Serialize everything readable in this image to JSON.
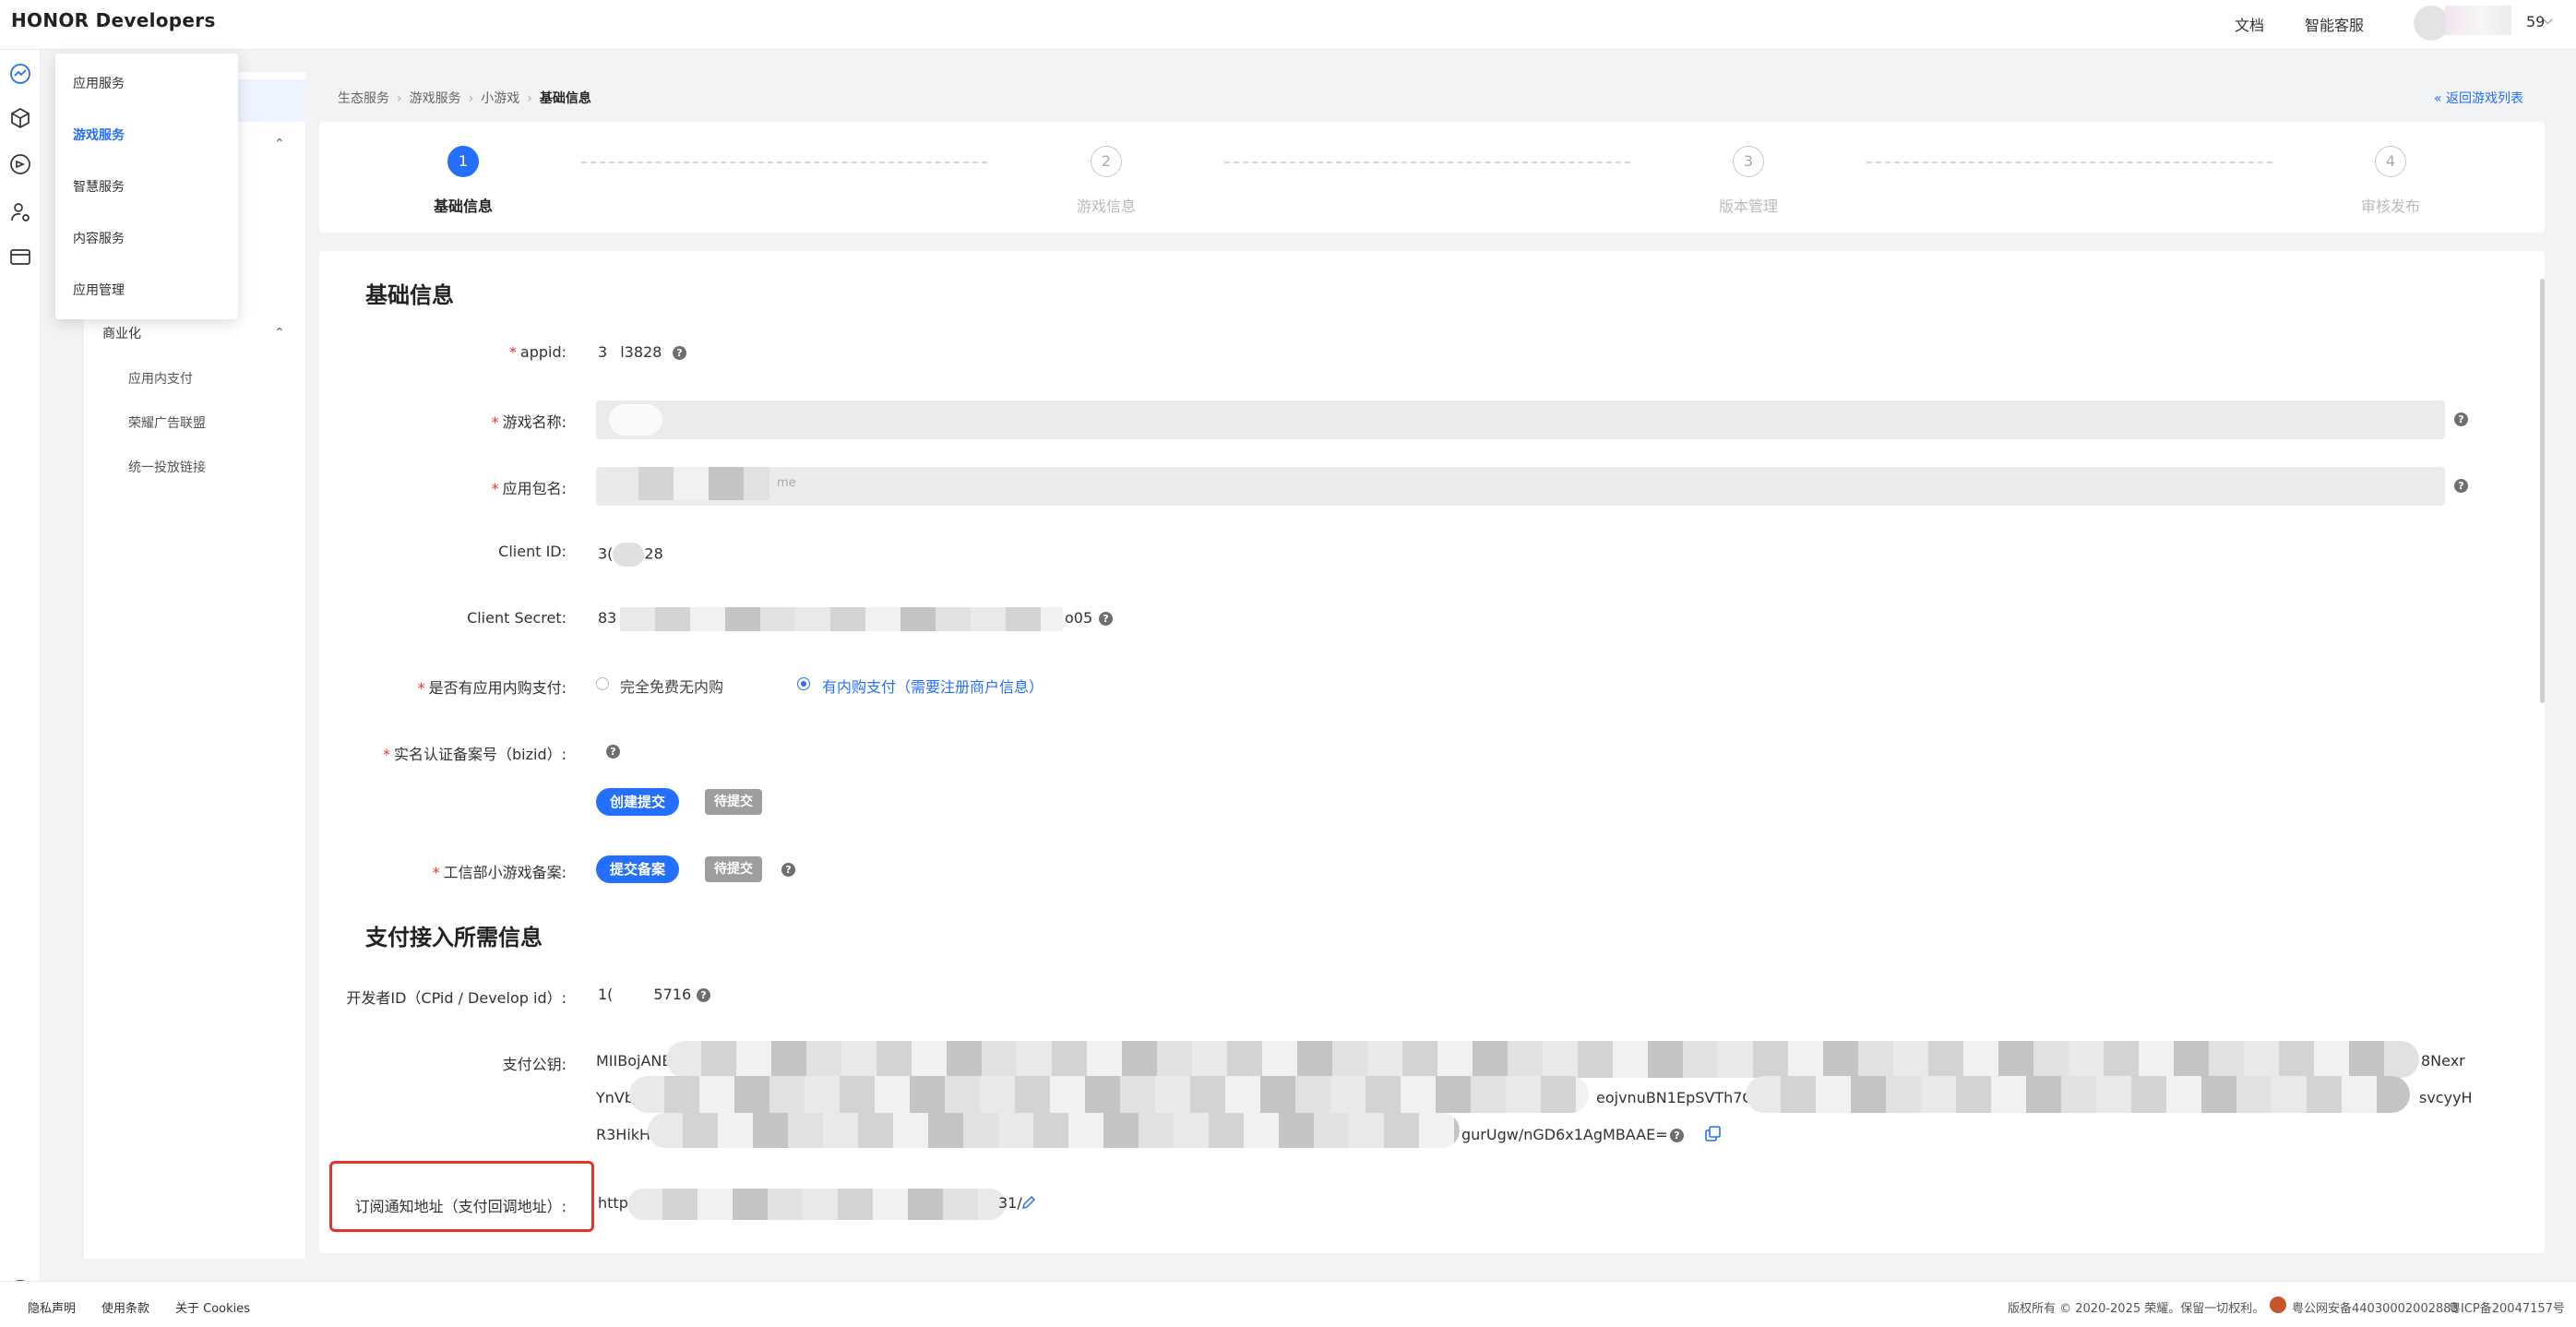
{
  "header": {
    "brand": "HONOR Developers",
    "links": [
      "文档",
      "智能客服"
    ],
    "user_suffix": "59"
  },
  "flyout": {
    "items": [
      "应用服务",
      "游戏服务",
      "智慧服务",
      "内容服务",
      "应用管理"
    ],
    "active_index": 1
  },
  "sidebar": {
    "group_label": "商业化",
    "sub_items": [
      "应用内支付",
      "荣耀广告联盟",
      "统一投放链接"
    ]
  },
  "breadcrumb": {
    "items": [
      "生态服务",
      "游戏服务",
      "小游戏"
    ],
    "current": "基础信息",
    "back": "返回游戏列表"
  },
  "steps": [
    {
      "num": "1",
      "label": "基础信息",
      "active": true
    },
    {
      "num": "2",
      "label": "游戏信息",
      "active": false
    },
    {
      "num": "3",
      "label": "版本管理",
      "active": false
    },
    {
      "num": "4",
      "label": "审核发布",
      "active": false
    }
  ],
  "form": {
    "section1_title": "基础信息",
    "appid": {
      "label": "appid:",
      "value_prefix": "3",
      "value_suffix": "l3828"
    },
    "game_name": {
      "label": "游戏名称:"
    },
    "package_name": {
      "label": "应用包名:",
      "value_suffix": "me"
    },
    "client_id": {
      "label": "Client ID:",
      "value_prefix": "3(",
      "value_suffix": "28"
    },
    "client_secret": {
      "label": "Client Secret:",
      "value_prefix": "83",
      "value_suffix": "o05"
    },
    "iap": {
      "label": "是否有应用内购支付:",
      "options": [
        "完全免费无内购",
        "有内购支付（需要注册商户信息）"
      ],
      "selected_index": 1
    },
    "bizid": {
      "label": "实名认证备案号（bizid）:",
      "button": "创建提交",
      "status": "待提交"
    },
    "miit": {
      "label": "工信部小游戏备案:",
      "button": "提交备案",
      "status": "待提交"
    },
    "section2_title": "支付接入所需信息",
    "developer_id": {
      "label": "开发者ID（CPid / Develop id）:",
      "value_prefix": "1(",
      "value_suffix": "5716"
    },
    "public_key": {
      "label": "支付公钥:",
      "line1_start": "MIIBojANB",
      "line1_end": "8Nexr",
      "line2_start": "YnVb",
      "line2_mid": "eojvnuBN1EpSVTh7C",
      "line2_end": "svcyyH",
      "line3_start": "R3HikH",
      "line3_end": "gurUgw/nGD6x1AgMBAAE="
    },
    "notify_url": {
      "label": "订阅通知地址（支付回调地址）:",
      "value_prefix": "http",
      "value_suffix": "31/"
    }
  },
  "footer": {
    "links": [
      "隐私声明",
      "使用条款",
      "关于 Cookies"
    ],
    "copyright": "版权所有 © 2020-2025 荣耀。保留一切权利。",
    "police_record": "粤公网安备44030002002883",
    "icp": "粤ICP备20047157号"
  },
  "colors": {
    "accent": "#256fff",
    "required": "#e5332b",
    "highlight": "#e5332b"
  }
}
